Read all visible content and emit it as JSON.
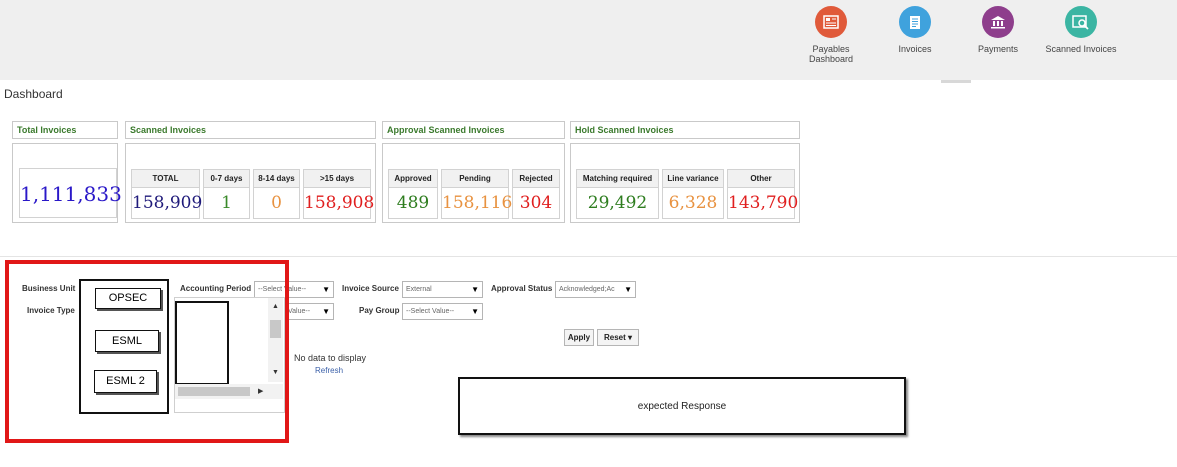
{
  "nav": {
    "items": [
      {
        "label_line1": "Payables",
        "label_line2": "Dashboard",
        "icon": "payables-dashboard-icon",
        "color": "#e05a3a"
      },
      {
        "label_line1": "Invoices",
        "label_line2": "",
        "icon": "invoices-icon",
        "color": "#3fa2dd"
      },
      {
        "label_line1": "Payments",
        "label_line2": "",
        "icon": "payments-icon",
        "color": "#8e3e8c"
      },
      {
        "label_line1": "Scanned Invoices",
        "label_line2": "",
        "icon": "scanned-invoices-icon",
        "color": "#3bb5a3"
      }
    ]
  },
  "page": {
    "title": "Dashboard"
  },
  "tiles": {
    "total": {
      "header": "Total Invoices",
      "value": "1,111,833"
    },
    "scanned": {
      "header": "Scanned Invoices",
      "stats": [
        {
          "label": "TOTAL",
          "value": "158,909",
          "color": "#1f1a7a"
        },
        {
          "label": "0-7 days",
          "value": "1",
          "color": "#3a8a2a"
        },
        {
          "label": "8-14 days",
          "value": "0",
          "color": "#e89240"
        },
        {
          "label": ">15 days",
          "value": "158,908",
          "color": "#e01f1f"
        }
      ]
    },
    "approval": {
      "header": "Approval Scanned Invoices",
      "stats": [
        {
          "label": "Approved",
          "value": "489",
          "color": "#2e7d1f"
        },
        {
          "label": "Pending",
          "value": "158,116",
          "color": "#e89240"
        },
        {
          "label": "Rejected",
          "value": "304",
          "color": "#e01f1f"
        }
      ]
    },
    "hold": {
      "header": "Hold Scanned Invoices",
      "stats": [
        {
          "label": "Matching required",
          "value": "29,492",
          "color": "#2e7d1f"
        },
        {
          "label": "Line variance",
          "value": "6,328",
          "color": "#e89240"
        },
        {
          "label": "Other",
          "value": "143,790",
          "color": "#e01f1f"
        }
      ]
    }
  },
  "filters": {
    "business_unit_label": "Business Unit",
    "invoice_type_label": "Invoice Type",
    "accounting_period_label": "Accounting Period",
    "accounting_period_value": "--Select Value--",
    "accounting_period_trunc": "...",
    "invoice_type_value": "Value--",
    "invoice_source_label": "Invoice Source",
    "invoice_source_value": "External",
    "pay_group_label": "Pay Group",
    "pay_group_value": "--Select Value--",
    "approval_status_label": "Approval Status",
    "approval_status_value": "Acknowledged;Ac",
    "apply_label": "Apply",
    "reset_label": "Reset ▾"
  },
  "dropdown": {
    "options": [
      "OPSEC",
      "ESML",
      "ESML 2"
    ]
  },
  "results": {
    "no_data": "No data to display",
    "refresh": "Refresh"
  },
  "annotation": {
    "expected": "expected Response"
  }
}
